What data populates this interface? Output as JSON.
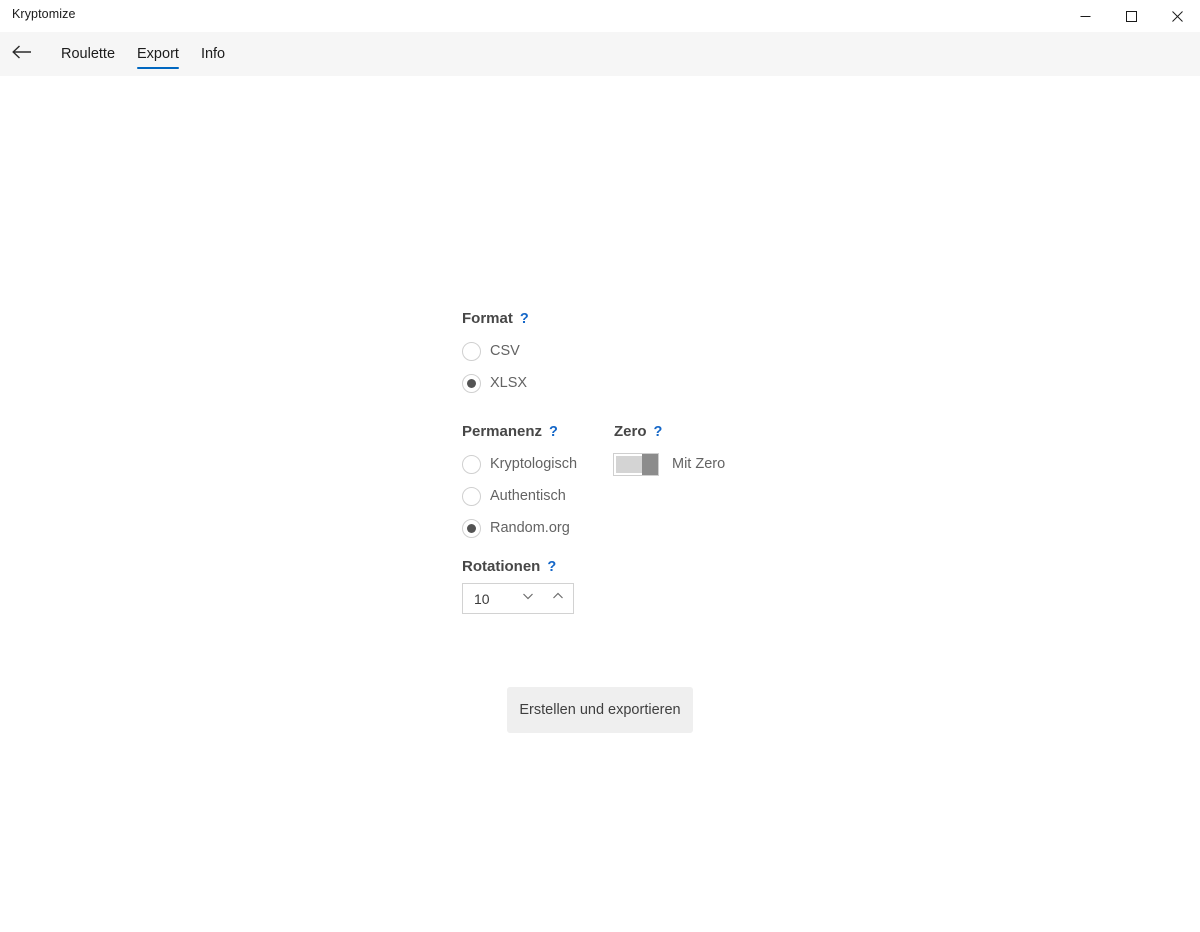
{
  "window": {
    "title": "Kryptomize",
    "caption_buttons": [
      {
        "name": "minimize",
        "label": "—"
      },
      {
        "name": "maximize",
        "label": "□"
      },
      {
        "name": "close",
        "label": "✕"
      }
    ]
  },
  "nav": {
    "back_icon": "back-arrow-icon",
    "tabs": [
      {
        "label": "Roulette",
        "active": false
      },
      {
        "label": "Export",
        "active": true
      },
      {
        "label": "Info",
        "active": false
      }
    ],
    "accent_color": "#0067c0"
  },
  "form": {
    "format": {
      "heading": "Format",
      "help": "?",
      "options": [
        {
          "label": "CSV",
          "selected": false
        },
        {
          "label": "XLSX",
          "selected": true
        }
      ]
    },
    "permanenz": {
      "heading": "Permanenz",
      "help": "?",
      "options": [
        {
          "label": "Kryptologisch",
          "selected": false
        },
        {
          "label": "Authentisch",
          "selected": false
        },
        {
          "label": "Random.org",
          "selected": true
        }
      ]
    },
    "zero": {
      "heading": "Zero",
      "help": "?",
      "toggle_label": "Mit Zero",
      "toggle_on": false
    },
    "rotationen": {
      "heading": "Rotationen",
      "help": "?",
      "value": "10",
      "decrement_icon": "chevron-down-icon",
      "increment_icon": "chevron-up-icon"
    },
    "submit_label": "Erstellen und exportieren"
  },
  "colors": {
    "accent": "#0067c0",
    "help": "#1567c8",
    "heading": "#474747",
    "label": "#636363",
    "button_bg": "#efefef",
    "navbar_bg": "#f6f6f6"
  }
}
